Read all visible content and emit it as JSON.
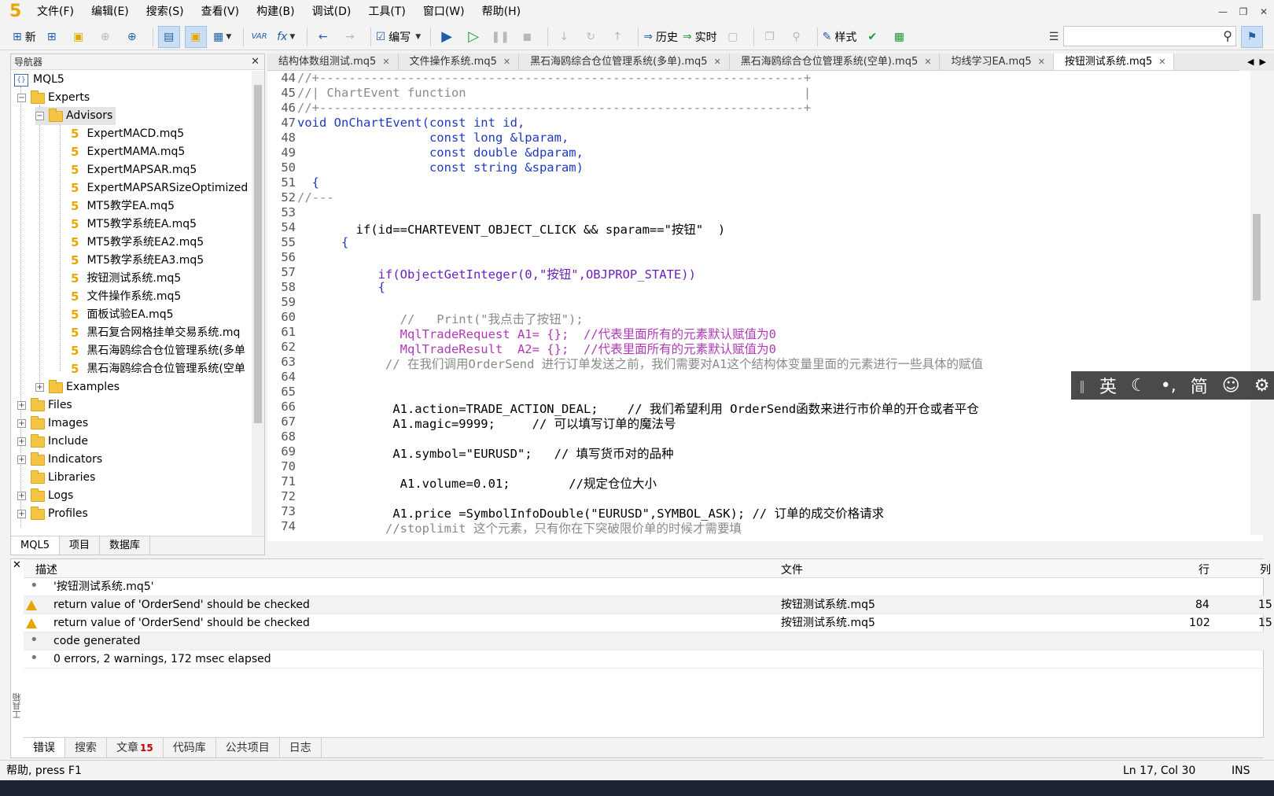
{
  "menubar": {
    "logo": "5",
    "items": [
      "文件(F)",
      "编辑(E)",
      "搜索(S)",
      "查看(V)",
      "构建(B)",
      "调试(D)",
      "工具(T)",
      "窗口(W)",
      "帮助(H)"
    ]
  },
  "toolbar": {
    "new_label": "新",
    "compile_label": "编写",
    "history_label": "历史",
    "realtime_label": "实时",
    "style_label": "样式",
    "var_label": "VAR",
    "fx_label": "fx"
  },
  "navigator": {
    "title": "导航器",
    "root": "MQL5",
    "experts": "Experts",
    "advisors": "Advisors",
    "files": [
      "ExpertMACD.mq5",
      "ExpertMAMA.mq5",
      "ExpertMAPSAR.mq5",
      "ExpertMAPSARSizeOptimized",
      "MT5教学EA.mq5",
      "MT5教学系统EA.mq5",
      "MT5教学系统EA2.mq5",
      "MT5教学系统EA3.mq5",
      "按钮测试系统.mq5",
      "文件操作系统.mq5",
      "面板试验EA.mq5",
      "黑石复合网格挂单交易系统.mq",
      "黑石海鸥综合仓位管理系统(多单",
      "黑石海鸥综合仓位管理系统(空单"
    ],
    "examples": "Examples",
    "folders": [
      "Files",
      "Images",
      "Include",
      "Indicators",
      "Libraries",
      "Logs",
      "Profiles"
    ],
    "tabs": [
      "MQL5",
      "项目",
      "数据库"
    ]
  },
  "editor_tabs": [
    "结构体数组测试.mq5",
    "文件操作系统.mq5",
    "黑石海鸥综合仓位管理系统(多单).mq5",
    "黑石海鸥综合仓位管理系统(空单).mq5",
    "均线学习EA.mq5",
    "按钮测试系统.mq5"
  ],
  "code_lines": [
    {
      "n": "44",
      "t": "//+------------------------------------------------------------------+"
    },
    {
      "n": "45",
      "t": "//| ChartEvent function                                              |"
    },
    {
      "n": "46",
      "t": "//+------------------------------------------------------------------+"
    },
    {
      "n": "47",
      "t": "void OnChartEvent(const int id,"
    },
    {
      "n": "48",
      "t": "                  const long &lparam,"
    },
    {
      "n": "49",
      "t": "                  const double &dparam,"
    },
    {
      "n": "50",
      "t": "                  const string &sparam)"
    },
    {
      "n": "51",
      "t": "  {"
    },
    {
      "n": "52",
      "t": "//---"
    },
    {
      "n": "53",
      "t": ""
    },
    {
      "n": "54",
      "t": "        if(id==CHARTEVENT_OBJECT_CLICK && sparam==\"按钮\"  )"
    },
    {
      "n": "55",
      "t": "      {"
    },
    {
      "n": "56",
      "t": ""
    },
    {
      "n": "57",
      "t": "           if(ObjectGetInteger(0,\"按钮\",OBJPROP_STATE))"
    },
    {
      "n": "58",
      "t": "           {"
    },
    {
      "n": "59",
      "t": ""
    },
    {
      "n": "60",
      "t": "              //   Print(\"我点击了按钮\");"
    },
    {
      "n": "61",
      "t": "              MqlTradeRequest A1= {};  //代表里面所有的元素默认赋值为0"
    },
    {
      "n": "62",
      "t": "              MqlTradeResult  A2= {};  //代表里面所有的元素默认赋值为0"
    },
    {
      "n": "63",
      "t": "            // 在我们调用OrderSend 进行订单发送之前，我们需要对A1这个结构体变量里面的元素进行一些具体的赋值"
    },
    {
      "n": "64",
      "t": ""
    },
    {
      "n": "65",
      "t": ""
    },
    {
      "n": "66",
      "t": "             A1.action=TRADE_ACTION_DEAL;    // 我们希望利用 OrderSend函数来进行市价单的开仓或者平仓"
    },
    {
      "n": "67",
      "t": "             A1.magic=9999;     // 可以填写订单的魔法号"
    },
    {
      "n": "68",
      "t": ""
    },
    {
      "n": "69",
      "t": "             A1.symbol=\"EURUSD\";   // 填写货币对的品种"
    },
    {
      "n": "70",
      "t": ""
    },
    {
      "n": "71",
      "t": "              A1.volume=0.01;        //规定仓位大小"
    },
    {
      "n": "72",
      "t": ""
    },
    {
      "n": "73",
      "t": "             A1.price =SymbolInfoDouble(\"EURUSD\",SYMBOL_ASK); // 订单的成交价格请求"
    },
    {
      "n": "74",
      "t": "            //stoplimit 这个元素，只有你在下突破限价单的时候才需要填"
    }
  ],
  "ime": {
    "lang": "英",
    "mode": "简"
  },
  "output": {
    "headers": {
      "desc": "描述",
      "file": "文件",
      "line": "行",
      "col": "列"
    },
    "rows": [
      {
        "icon": "dot",
        "desc": "'按钮测试系统.mq5'",
        "file": "",
        "line": "",
        "col": ""
      },
      {
        "icon": "warning",
        "desc": "return value of 'OrderSend' should be checked",
        "file": "按钮测试系统.mq5",
        "line": "84",
        "col": "15"
      },
      {
        "icon": "warning",
        "desc": "return value of 'OrderSend' should be checked",
        "file": "按钮测试系统.mq5",
        "line": "102",
        "col": "15"
      },
      {
        "icon": "dot",
        "desc": "code generated",
        "file": "",
        "line": "",
        "col": ""
      },
      {
        "icon": "dot",
        "desc": "0 errors, 2 warnings, 172 msec elapsed",
        "file": "",
        "line": "",
        "col": ""
      }
    ],
    "toolbox_label": "工具箱",
    "tabs": [
      "错误",
      "搜索",
      "文章",
      "代码库",
      "公共项目",
      "日志"
    ],
    "articles_badge": "15"
  },
  "status": {
    "help": "帮助, press F1",
    "position": "Ln 17, Col 30",
    "mode": "INS"
  }
}
